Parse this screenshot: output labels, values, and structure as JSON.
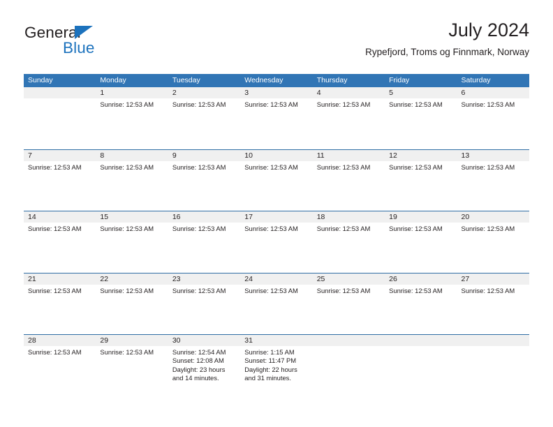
{
  "brand": {
    "name_dark": "General",
    "name_blue": "Blue",
    "accent_color": "#1c72bd"
  },
  "header": {
    "title": "July 2024",
    "subtitle": "Rypefjord, Troms og Finnmark, Norway"
  },
  "theme": {
    "header_blue": "#3175b5",
    "row_rule_blue": "#2e6da4",
    "day_strip_gray": "#f0f0f0",
    "text_color": "#231f20",
    "background": "#ffffff"
  },
  "weekday_headers": [
    "Sunday",
    "Monday",
    "Tuesday",
    "Wednesday",
    "Thursday",
    "Friday",
    "Saturday"
  ],
  "weeks": [
    [
      {
        "day": "",
        "lines": []
      },
      {
        "day": "1",
        "lines": [
          "Sunrise: 12:53 AM"
        ]
      },
      {
        "day": "2",
        "lines": [
          "Sunrise: 12:53 AM"
        ]
      },
      {
        "day": "3",
        "lines": [
          "Sunrise: 12:53 AM"
        ]
      },
      {
        "day": "4",
        "lines": [
          "Sunrise: 12:53 AM"
        ]
      },
      {
        "day": "5",
        "lines": [
          "Sunrise: 12:53 AM"
        ]
      },
      {
        "day": "6",
        "lines": [
          "Sunrise: 12:53 AM"
        ]
      }
    ],
    [
      {
        "day": "7",
        "lines": [
          "Sunrise: 12:53 AM"
        ]
      },
      {
        "day": "8",
        "lines": [
          "Sunrise: 12:53 AM"
        ]
      },
      {
        "day": "9",
        "lines": [
          "Sunrise: 12:53 AM"
        ]
      },
      {
        "day": "10",
        "lines": [
          "Sunrise: 12:53 AM"
        ]
      },
      {
        "day": "11",
        "lines": [
          "Sunrise: 12:53 AM"
        ]
      },
      {
        "day": "12",
        "lines": [
          "Sunrise: 12:53 AM"
        ]
      },
      {
        "day": "13",
        "lines": [
          "Sunrise: 12:53 AM"
        ]
      }
    ],
    [
      {
        "day": "14",
        "lines": [
          "Sunrise: 12:53 AM"
        ]
      },
      {
        "day": "15",
        "lines": [
          "Sunrise: 12:53 AM"
        ]
      },
      {
        "day": "16",
        "lines": [
          "Sunrise: 12:53 AM"
        ]
      },
      {
        "day": "17",
        "lines": [
          "Sunrise: 12:53 AM"
        ]
      },
      {
        "day": "18",
        "lines": [
          "Sunrise: 12:53 AM"
        ]
      },
      {
        "day": "19",
        "lines": [
          "Sunrise: 12:53 AM"
        ]
      },
      {
        "day": "20",
        "lines": [
          "Sunrise: 12:53 AM"
        ]
      }
    ],
    [
      {
        "day": "21",
        "lines": [
          "Sunrise: 12:53 AM"
        ]
      },
      {
        "day": "22",
        "lines": [
          "Sunrise: 12:53 AM"
        ]
      },
      {
        "day": "23",
        "lines": [
          "Sunrise: 12:53 AM"
        ]
      },
      {
        "day": "24",
        "lines": [
          "Sunrise: 12:53 AM"
        ]
      },
      {
        "day": "25",
        "lines": [
          "Sunrise: 12:53 AM"
        ]
      },
      {
        "day": "26",
        "lines": [
          "Sunrise: 12:53 AM"
        ]
      },
      {
        "day": "27",
        "lines": [
          "Sunrise: 12:53 AM"
        ]
      }
    ],
    [
      {
        "day": "28",
        "lines": [
          "Sunrise: 12:53 AM"
        ]
      },
      {
        "day": "29",
        "lines": [
          "Sunrise: 12:53 AM"
        ]
      },
      {
        "day": "30",
        "lines": [
          "Sunrise: 12:54 AM",
          "Sunset: 12:08 AM",
          "Daylight: 23 hours",
          "and 14 minutes."
        ]
      },
      {
        "day": "31",
        "lines": [
          "Sunrise: 1:15 AM",
          "Sunset: 11:47 PM",
          "Daylight: 22 hours",
          "and 31 minutes."
        ]
      },
      {
        "day": "",
        "lines": []
      },
      {
        "day": "",
        "lines": []
      },
      {
        "day": "",
        "lines": []
      }
    ]
  ]
}
